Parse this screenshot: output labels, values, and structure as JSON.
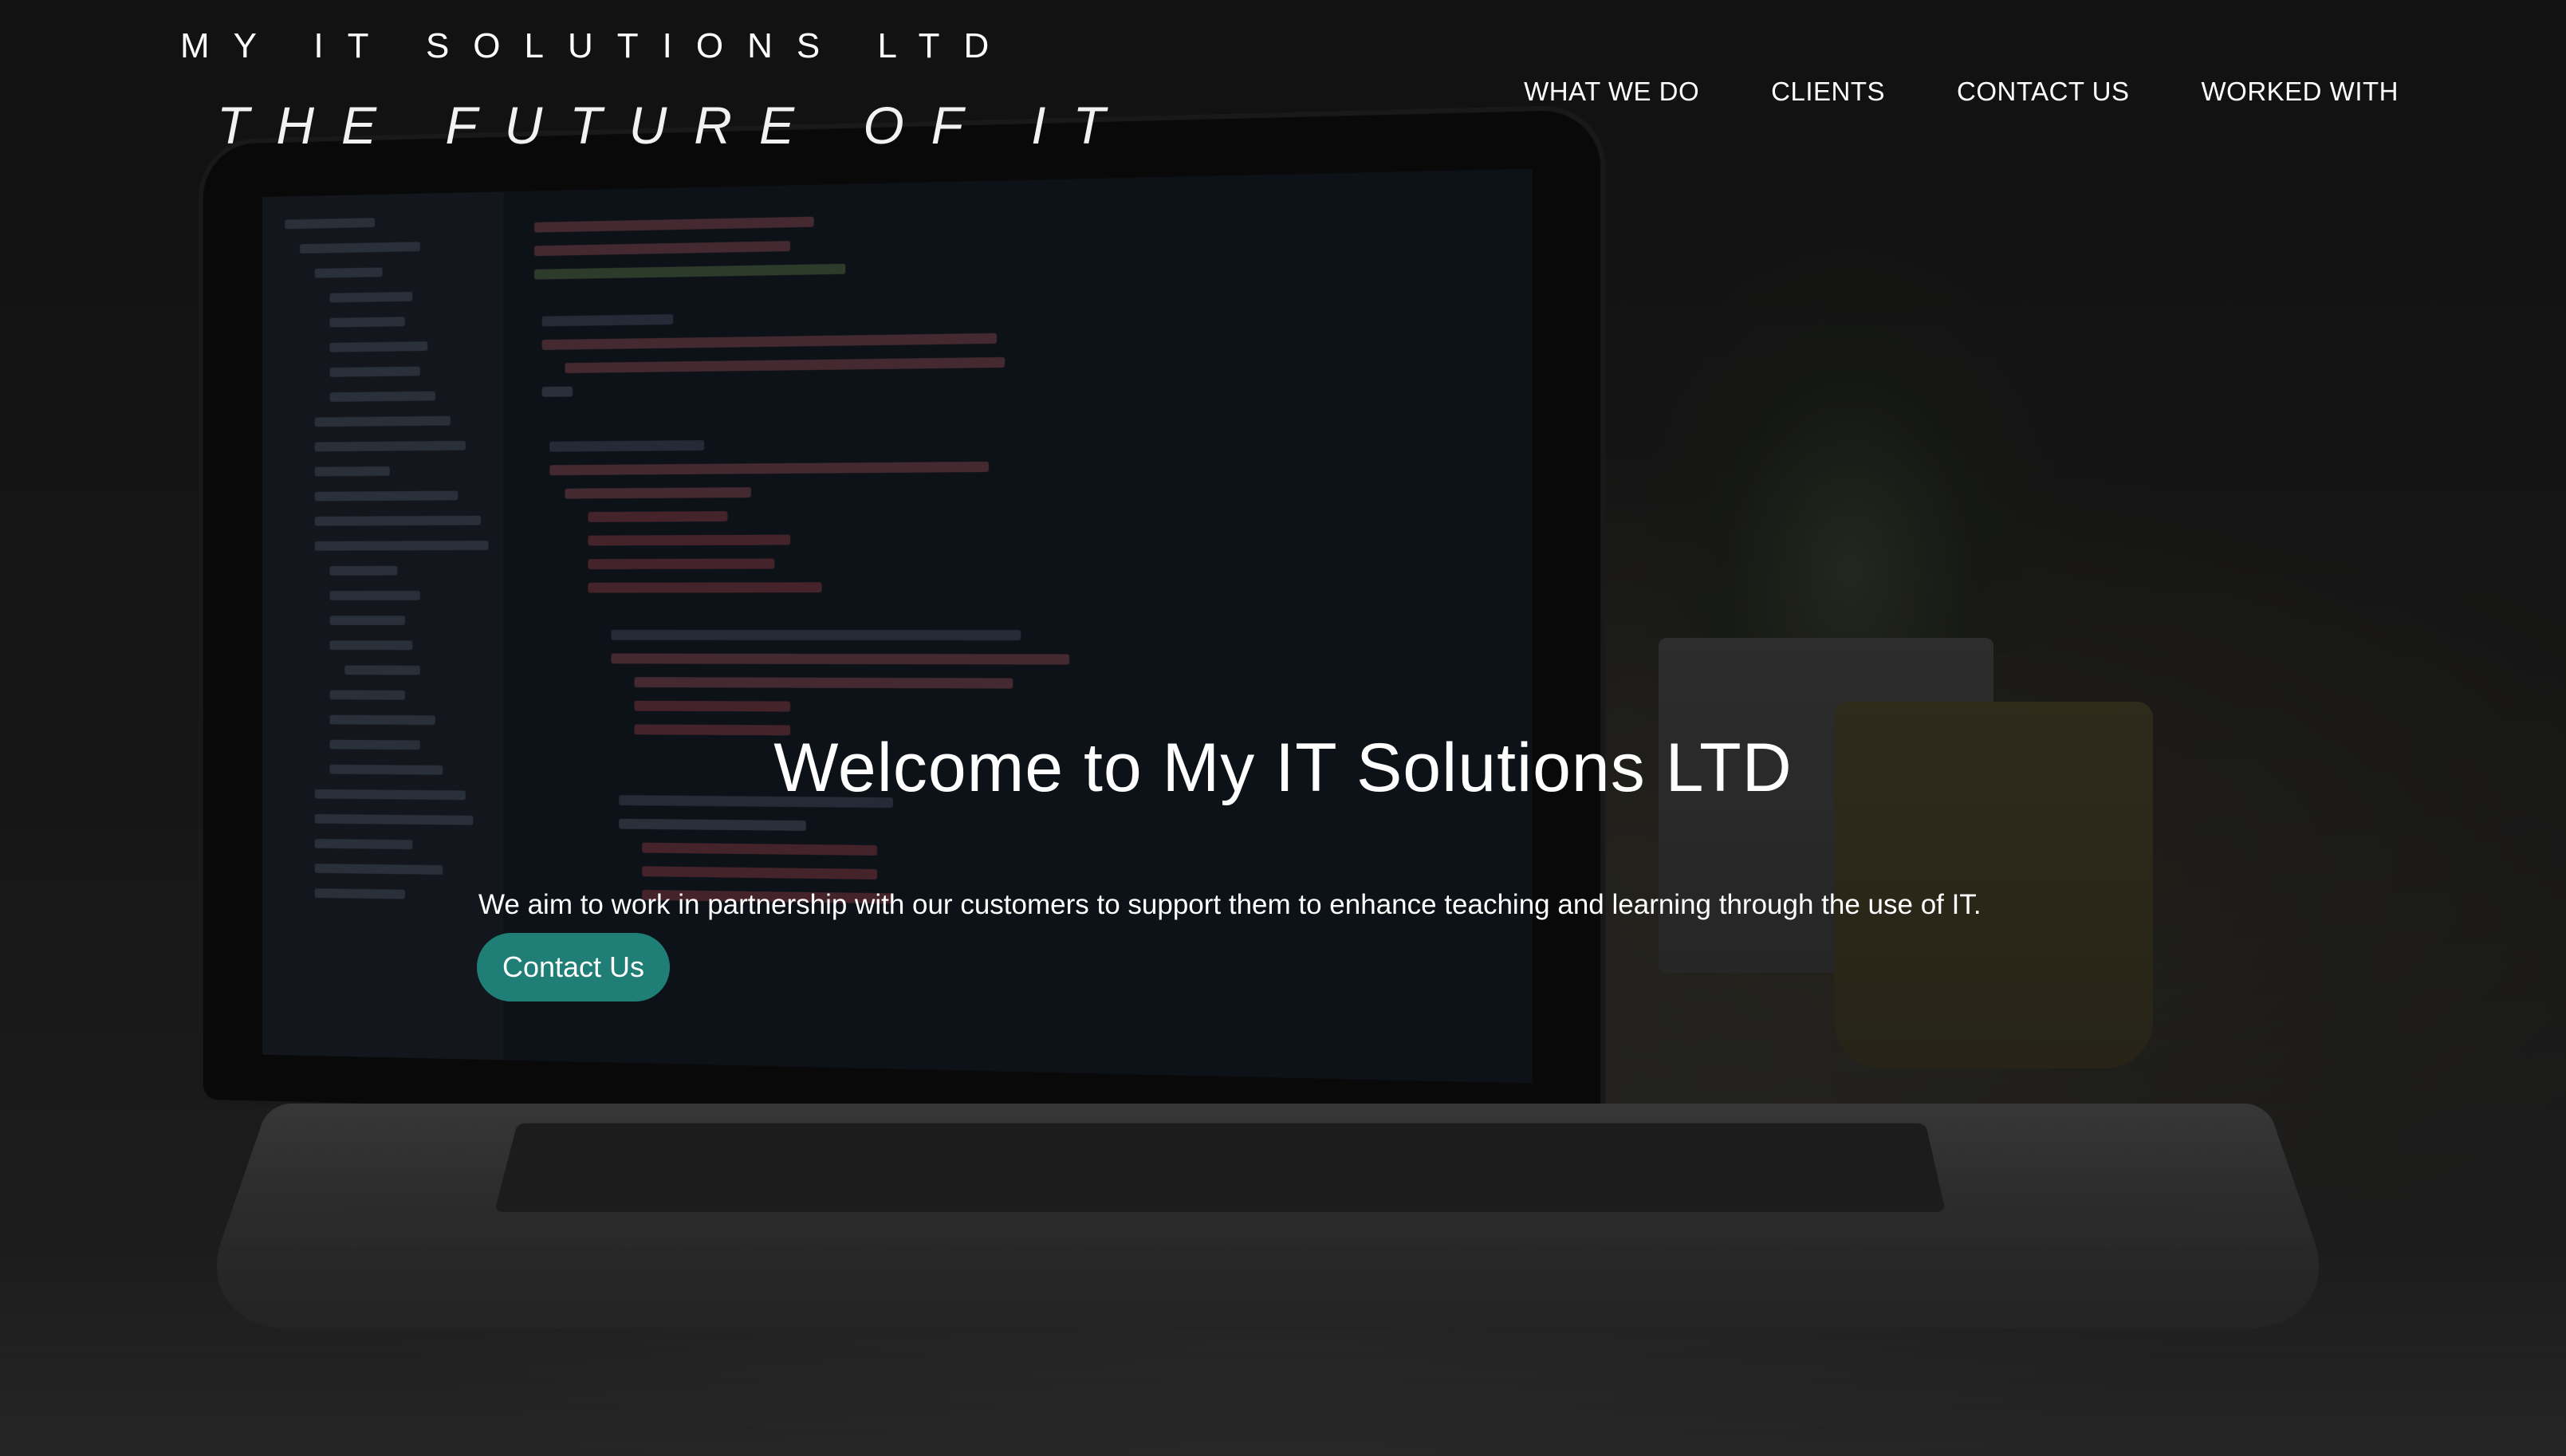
{
  "brand": {
    "name": "MY IT SOLUTIONS LTD",
    "tagline": "THE FUTURE OF IT"
  },
  "nav": {
    "items": [
      {
        "label": "WHAT WE DO"
      },
      {
        "label": "CLIENTS"
      },
      {
        "label": "CONTACT US"
      },
      {
        "label": "WORKED WITH"
      }
    ]
  },
  "hero": {
    "title": "Welcome to My IT Solutions LTD",
    "text": "We aim to work in partnership with our customers to support them to enhance teaching and learning through the use of IT.",
    "cta_label": "Contact Us",
    "background_image": "laptop-on-desk-photo"
  },
  "colors": {
    "accent": "#1f7f76",
    "text": "#ffffff",
    "background": "#1b1b1b"
  }
}
